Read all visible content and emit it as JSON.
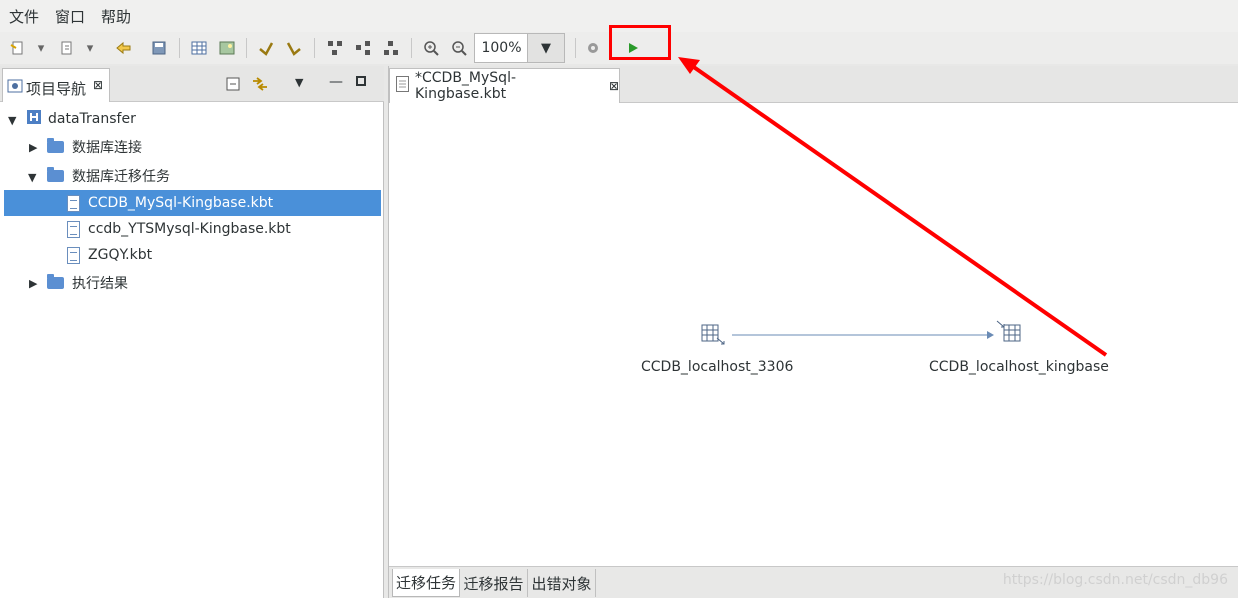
{
  "menu": {
    "items": [
      "文件",
      "窗口",
      "帮助"
    ]
  },
  "toolbar": {
    "zoom_value": "100%"
  },
  "navigator": {
    "title": "项目导航",
    "tree": {
      "project": "dataTransfer",
      "folders": [
        "数据库连接",
        "数据库迁移任务",
        "执行结果"
      ],
      "files": [
        "CCDB_MySql-Kingbase.kbt",
        "ccdb_YTSMysql-Kingbase.kbt",
        "ZGQY.kbt"
      ]
    }
  },
  "editor": {
    "tab_title": "*CCDB_MySql-Kingbase.kbt",
    "source_node": "CCDB_localhost_3306",
    "target_node": "CCDB_localhost_kingbase",
    "bottom_tabs": [
      "迁移任务",
      "迁移报告",
      "出错对象"
    ]
  },
  "watermark": "https://blog.csdn.net/csdn_db96",
  "colors": {
    "selection": "#4a90d9",
    "annotation": "#ff0000",
    "run_icon": "#2a9a2a"
  },
  "icons": [
    "new-wizard-icon",
    "save-icon",
    "table-icon",
    "undo-icon",
    "redo-icon",
    "zoom-in-icon",
    "zoom-out-icon",
    "settings-icon",
    "run-icon",
    "close-icon",
    "minimize-icon",
    "maximize-icon"
  ]
}
